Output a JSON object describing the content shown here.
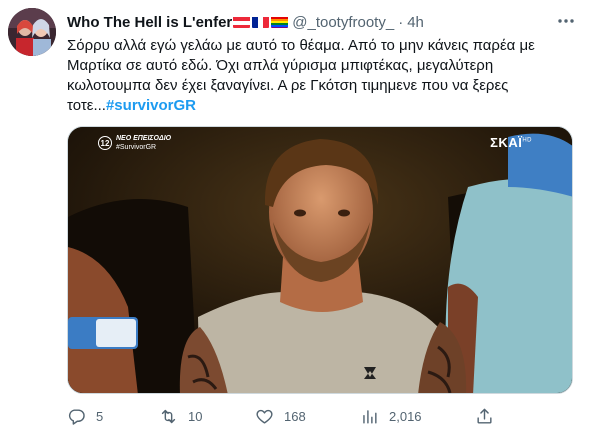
{
  "tweet": {
    "author": {
      "display_name": "Who The Hell is L'enfer",
      "handle": "@_tootyfrooty_",
      "flags": [
        "austria-flag",
        "france-flag",
        "rainbow-flag"
      ]
    },
    "separator": "·",
    "time": "4h",
    "text_lines": [
      "Σόρρυ αλλά εγώ γελάω με αυτό το θέαμα. Από το μην κάνεις παρέα με",
      "Μαρτίκα σε αυτό εδώ. Όχι απλά γύρισμα μπιφτέκας, μεγαλύτερη",
      "κωλοτουμπα δεν έχει ξαναγίνει. Α ρε Γκότση τιμημενε που να ξερες",
      "τοτε..."
    ],
    "hashtag": "#survivorGR",
    "media": {
      "overlay_badge_number": "12",
      "overlay_title": "ΝΕΟ ΕΠΕΙΣΟΔΙΟ",
      "overlay_tag": "#SurvivorGR",
      "channel_logo": "ΣΚΑΪ",
      "channel_logo_suffix": "HD"
    },
    "metrics": {
      "replies": "5",
      "retweets": "10",
      "likes": "168",
      "views": "2,016"
    }
  },
  "icons": {
    "more": "more-horizontal-icon",
    "reply": "reply-icon",
    "retweet": "retweet-icon",
    "like": "heart-icon",
    "views": "views-chart-icon",
    "share": "share-icon"
  },
  "colors": {
    "text_primary": "#0f1419",
    "text_secondary": "#536471",
    "link": "#1d9bf0"
  }
}
